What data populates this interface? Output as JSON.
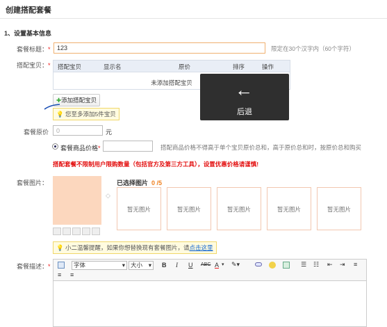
{
  "page": {
    "title": "创建搭配套餐",
    "section": "1、设置基本信息"
  },
  "name_field": {
    "label": "套餐标题：",
    "required": "*",
    "value": "123",
    "hint": "限定在30个汉字内（60个字符）"
  },
  "items": {
    "label": "搭配宝贝：",
    "required": "*",
    "columns": [
      "搭配宝贝",
      "显示名",
      "原价",
      "排序",
      "操作"
    ],
    "empty_text": "未添加搭配宝贝",
    "add_button": "添加搭配宝贝",
    "tip": "您至多添加5件宝贝"
  },
  "overlay": {
    "label": "后退",
    "icon": "back-arrow-icon"
  },
  "original_price": {
    "label": "套餐原价",
    "value": "0",
    "unit": "元"
  },
  "price": {
    "label": "套餐商品价格",
    "required": "*",
    "hint": "搭配商品价格不得高于单个宝贝原价总和，高于原价总和时，按原价总和购买",
    "warning": "搭配套餐不限制用户限购数量（包括官方及第三方工具），设置优惠价格请谨慎!"
  },
  "images": {
    "label": "套餐图片：",
    "selected_label": "已选择图片",
    "count": "0 /5",
    "placeholder": "暂无图片",
    "slots": [
      "暂无图片",
      "暂无图片",
      "暂无图片",
      "暂无图片",
      "暂无图片"
    ],
    "tip_text": "小二温馨提醒，如果你想替换现有套餐图片，请",
    "tip_link": "点击这里"
  },
  "description": {
    "label": "套餐描述：",
    "required": "*",
    "font_family": "字体",
    "font_size": "大小",
    "format_buttons": [
      "B",
      "I",
      "U",
      "ABC",
      "A"
    ]
  },
  "colors": {
    "accent_red": "#e30e0e",
    "image_bg": "#fcd7be",
    "overlay": "#2f2f2f"
  }
}
